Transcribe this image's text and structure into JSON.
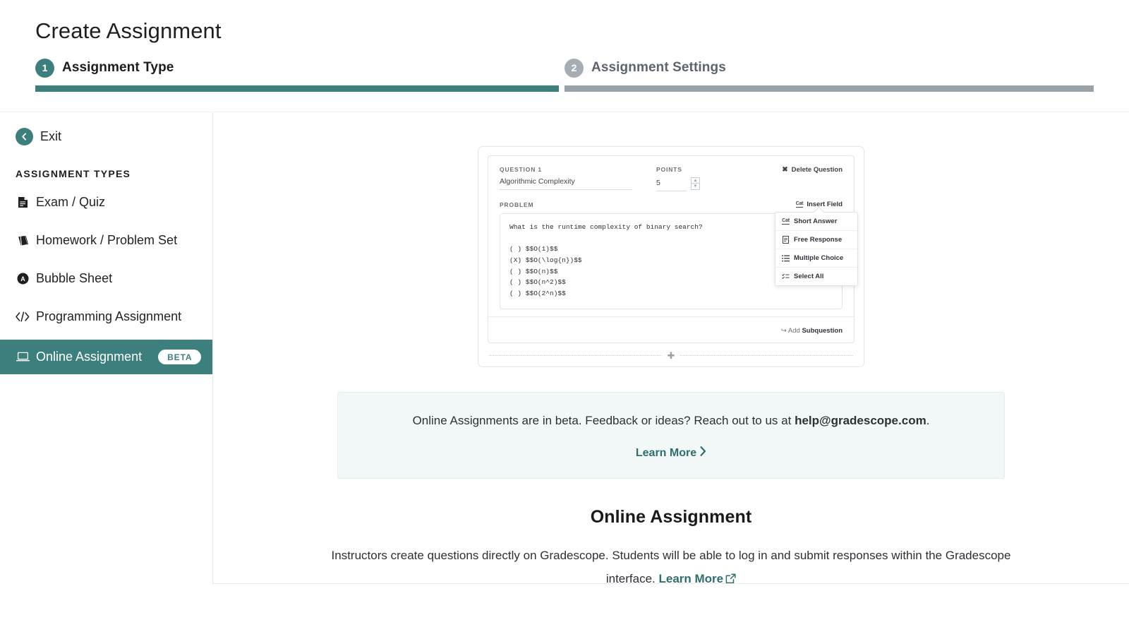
{
  "page": {
    "title": "Create Assignment"
  },
  "wizard": {
    "steps": [
      {
        "number": "1",
        "label": "Assignment Type",
        "state": "active"
      },
      {
        "number": "2",
        "label": "Assignment Settings",
        "state": "inactive"
      }
    ]
  },
  "sidebar": {
    "exit_label": "Exit",
    "exit_icon": "chevron-left-icon",
    "section_heading": "ASSIGNMENT TYPES",
    "items": [
      {
        "label": "Exam / Quiz",
        "icon": "document-icon",
        "selected": false,
        "badge": ""
      },
      {
        "label": "Homework / Problem Set",
        "icon": "book-icon",
        "selected": false,
        "badge": ""
      },
      {
        "label": "Bubble Sheet",
        "icon": "bubble-a-icon",
        "selected": false,
        "badge": ""
      },
      {
        "label": "Programming Assignment",
        "icon": "code-brackets-icon",
        "selected": false,
        "badge": ""
      },
      {
        "label": "Online Assignment",
        "icon": "laptop-icon",
        "selected": true,
        "badge": "BETA"
      }
    ]
  },
  "preview": {
    "question_label": "QUESTION 1",
    "question_title": "Algorithmic Complexity",
    "points_label": "POINTS",
    "points_value": "5",
    "delete_label": "Delete Question",
    "delete_icon": "x-icon",
    "problem_label": "PROBLEM",
    "insert_field_label": "Insert Field",
    "insert_field_icon": "text-field-icon",
    "problem_text": "What is the runtime complexity of binary search?\n\n( ) $$O(1)$$\n(X) $$O(\\log{n})$$\n( ) $$O(n)$$\n( ) $$O(n^2)$$\n( ) $$O(2^n)$$",
    "add_subquestion_prefix": "Add ",
    "add_subquestion_bold": "Subquestion",
    "add_subquestion_icon": "return-arrow-icon",
    "add_question_icon": "plus-icon",
    "insert_menu": [
      {
        "label": "Short Answer",
        "icon": "text-field-icon"
      },
      {
        "label": "Free Response",
        "icon": "document-icon"
      },
      {
        "label": "Multiple Choice",
        "icon": "list-icon"
      },
      {
        "label": "Select All",
        "icon": "checklist-icon"
      }
    ]
  },
  "beta_notice": {
    "text_before": "Online Assignments are in beta. Feedback or ideas? Reach out to us at ",
    "email": "help@gradescope.com",
    "text_after": ".",
    "learn_more_label": "Learn More",
    "learn_more_icon": "chevron-right-icon"
  },
  "description": {
    "title": "Online Assignment",
    "body_line1": "Instructors create questions directly on Gradescope. Students will be able to log in and submit responses within the",
    "body_line2_before": "Gradescope interface. ",
    "link_label": "Learn More",
    "link_icon": "external-link-icon"
  },
  "colors": {
    "accent_teal": "#3d7f7d",
    "link_teal": "#2e6e6d",
    "inactive_gray": "#9aa2a9",
    "notice_bg": "#f2f7f7"
  }
}
